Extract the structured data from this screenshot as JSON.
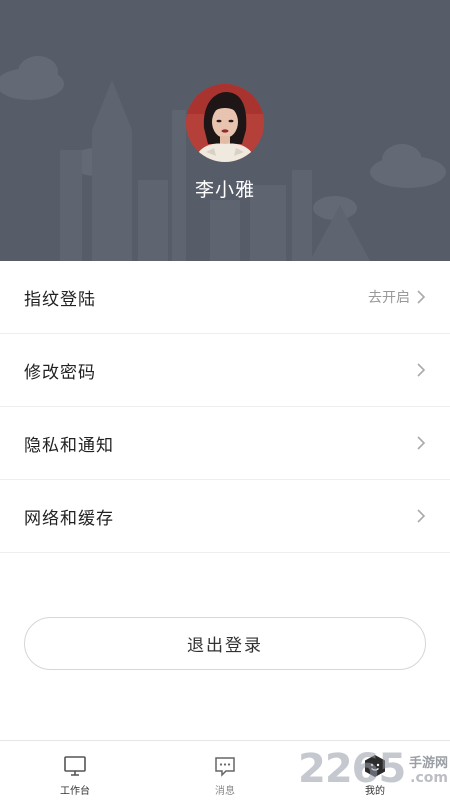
{
  "profile": {
    "name": "李小雅",
    "avatar_icon": "user-photo"
  },
  "menu": {
    "items": [
      {
        "label": "指纹登陆",
        "hint": "去开启"
      },
      {
        "label": "修改密码",
        "hint": ""
      },
      {
        "label": "隐私和通知",
        "hint": ""
      },
      {
        "label": "网络和缓存",
        "hint": ""
      }
    ]
  },
  "logout": {
    "label": "退出登录"
  },
  "tabbar": {
    "tabs": [
      {
        "label": "工作台",
        "icon": "monitor-icon",
        "active": false
      },
      {
        "label": "消息",
        "icon": "message-icon",
        "active": false
      },
      {
        "label": "我的",
        "icon": "profile-icon",
        "active": true
      }
    ]
  },
  "watermark": {
    "number": "2265",
    "site": "手游网",
    "domain": ".com"
  },
  "colors": {
    "header_bg": "#575c69",
    "text_primary": "#222222",
    "text_hint": "#999999",
    "divider": "#eeeeee"
  }
}
